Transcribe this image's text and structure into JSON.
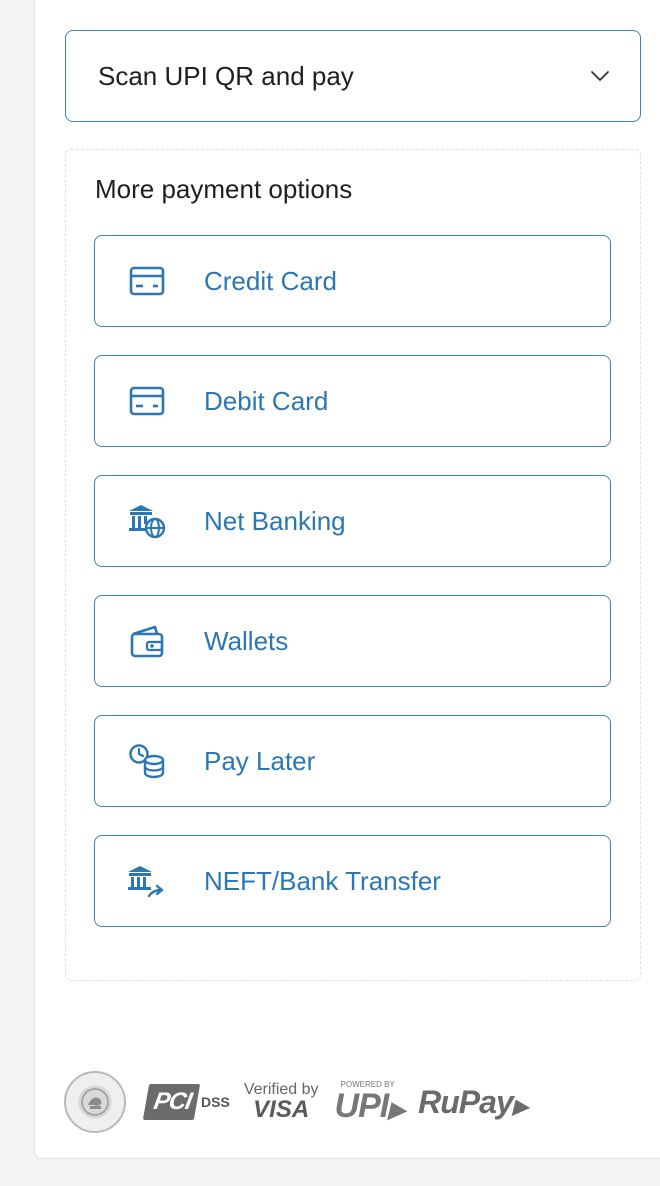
{
  "qr_section": {
    "label": "Scan UPI QR and pay"
  },
  "more_options": {
    "title": "More payment options",
    "items": [
      {
        "label": "Credit Card",
        "icon": "credit-card-icon"
      },
      {
        "label": "Debit Card",
        "icon": "debit-card-icon"
      },
      {
        "label": "Net Banking",
        "icon": "net-banking-icon"
      },
      {
        "label": "Wallets",
        "icon": "wallet-icon"
      },
      {
        "label": "Pay Later",
        "icon": "pay-later-icon"
      },
      {
        "label": "NEFT/Bank Transfer",
        "icon": "bank-transfer-icon"
      }
    ]
  },
  "trust_badges": {
    "pci": "PCI",
    "dss": "DSS",
    "visa_top": "Verified by",
    "visa_bottom": "VISA",
    "upi_top": "POWERED BY",
    "upi": "UPI",
    "rupay": "RuPay"
  },
  "colors": {
    "accent": "#2a77b3",
    "border": "#3e82b7",
    "text": "#1f1f1f",
    "background": "#f3f3f5"
  }
}
